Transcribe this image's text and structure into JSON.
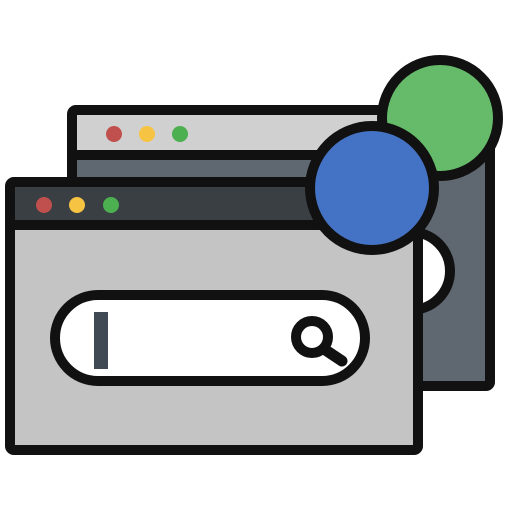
{
  "illustration": {
    "icon": "multiple-browser-windows-search-icon",
    "back_window": {
      "icon": "browser-window-icon",
      "traffic_lights": [
        "#c0504d",
        "#f6c343",
        "#4caf50"
      ],
      "badge_color": "#66bb6a"
    },
    "front_window": {
      "icon": "browser-window-icon",
      "traffic_lights": [
        "#c0504d",
        "#f6c343",
        "#4caf50"
      ],
      "badge_color": "#4472c4",
      "search_bar": {
        "value": "",
        "icon": "magnifier-icon"
      }
    }
  },
  "colors": {
    "outline": "#111111",
    "window_body_light": "#c4c4c4",
    "window_body_dark": "#5f6770",
    "title_bar": "#3a3f44",
    "title_bar_back": "#d0d0d0",
    "search_field": "#ffffff",
    "caret": "#3f4a54"
  }
}
